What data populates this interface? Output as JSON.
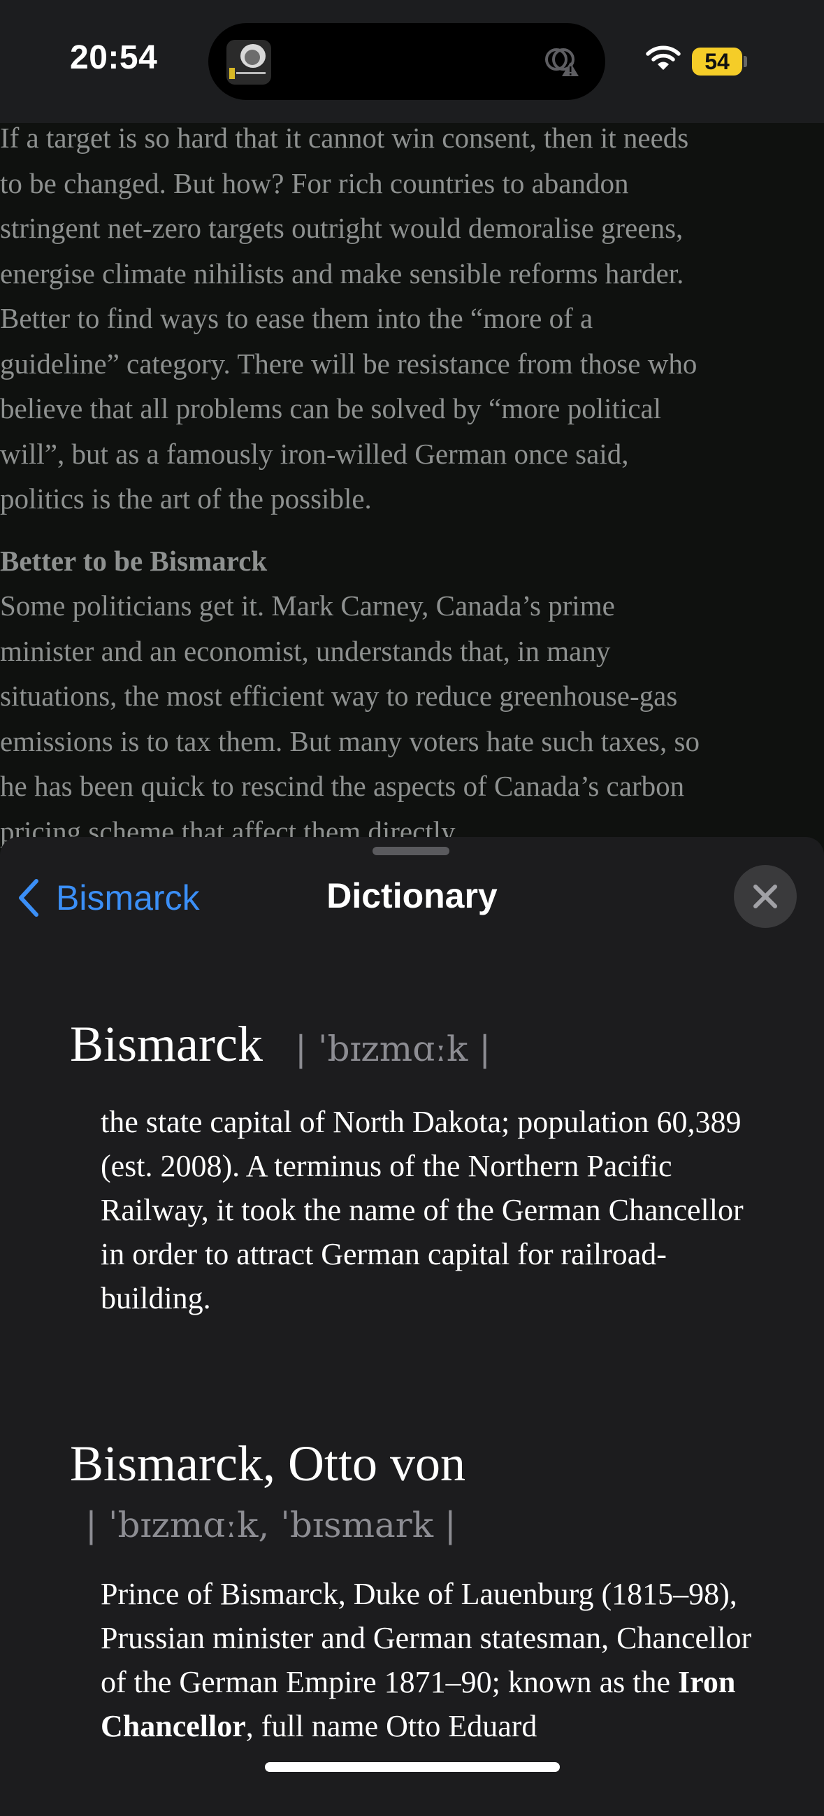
{
  "status_bar": {
    "time": "20:54",
    "battery": "54"
  },
  "article": {
    "paragraph1": [
      "If a target is so hard that it cannot win consent, then it needs",
      "to be changed. But how? For rich countries to abandon",
      "stringent net-zero targets outright would demoralise greens,",
      "energise climate nihilists and make sensible reforms harder.",
      "Better to find ways to ease them into the “more of a",
      "guideline” category. There will be resistance from those who",
      "believe that all problems can be solved by “more political",
      "will”, but as a famously iron-willed German once said,",
      "politics is the art of the possible."
    ],
    "subhead": "Better to be Bismarck",
    "paragraph2": [
      "Some politicians get it. Mark Carney, Canada’s prime",
      "minister and an economist, understands that, in many",
      "situations, the most efficient way to reduce greenhouse-gas",
      "emissions is to tax them. But many voters hate such taxes, so",
      "he has been quick to rescind the aspects of Canada’s carbon",
      "pricing scheme that affect them directly."
    ]
  },
  "sheet": {
    "back_label": "Bismarck",
    "title": "Dictionary",
    "entries": [
      {
        "headword": "Bismarck",
        "pronunciation": "| ˈbɪzmɑːk |",
        "definition": "the state capital of North Dakota; population 60,389 (est. 2008). A terminus of the Northern Pacific Railway, it took the name of the German Chancellor in order to attract German capital for railroad-building."
      },
      {
        "headword": "Bismarck, Otto von",
        "pronunciation": "| ˈbɪzmɑːk, ˈbɪsmark |",
        "definition_pre": "Prince of Bismarck, Duke of Lauenburg (1815–98), Prussian minister and German statesman, Chancellor of the German Empire 1871–90; known as the ",
        "definition_bold": "Iron Chancellor",
        "definition_post": ", full name Otto Eduard"
      }
    ]
  }
}
